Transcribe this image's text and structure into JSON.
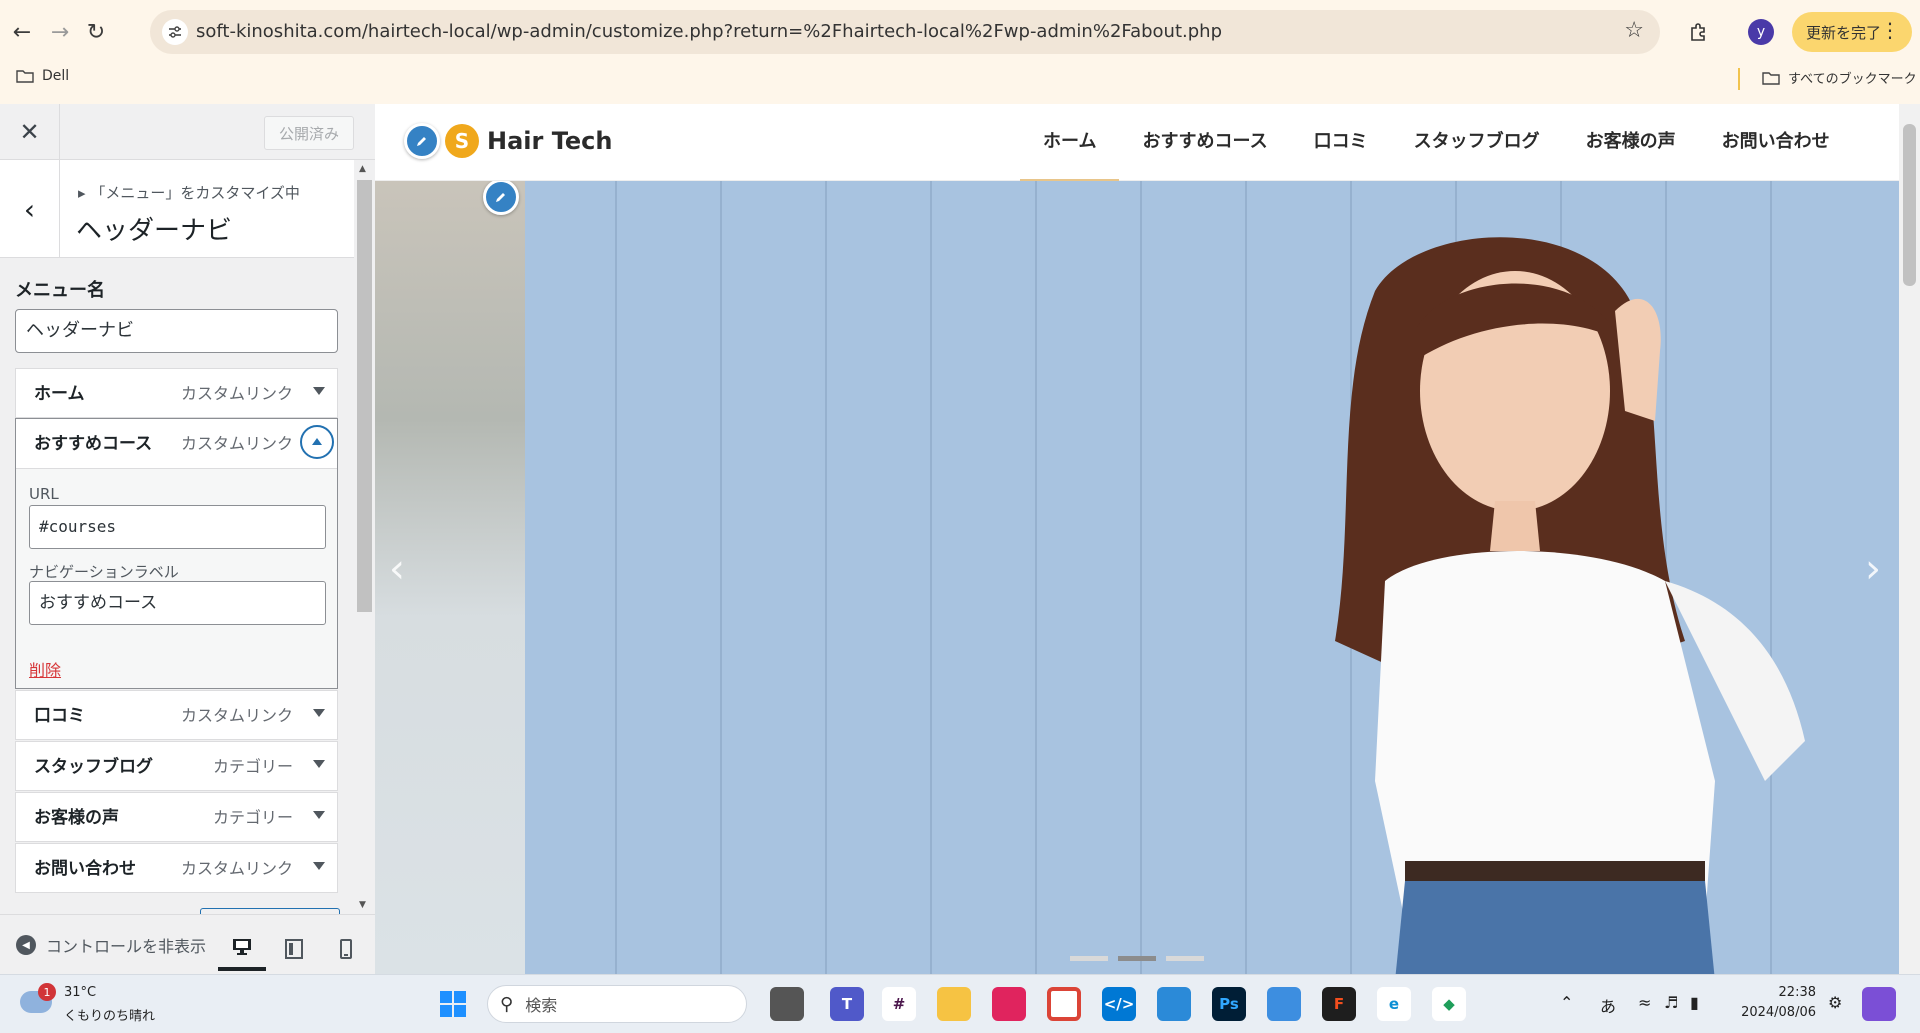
{
  "browser": {
    "url": "soft-kinoshita.com/hairtech-local/wp-admin/customize.php?return=%2Fhairtech-local%2Fwp-admin%2Fabout.php",
    "profile_initial": "y",
    "update_label": "更新を完了",
    "bookmarks": {
      "left": "Dell",
      "right": "すべてのブックマーク"
    }
  },
  "customizer": {
    "published_label": "公開済み",
    "breadcrumb": "「メニュー」をカスタマイズ中",
    "section_title": "ヘッダーナビ",
    "menu_name_label": "メニュー名",
    "menu_name_value": "ヘッダーナビ",
    "items": [
      {
        "title": "ホーム",
        "type": "カスタムリンク"
      },
      {
        "title": "おすすめコース",
        "type": "カスタムリンク"
      },
      {
        "title": "口コミ",
        "type": "カスタムリンク"
      },
      {
        "title": "スタッフブログ",
        "type": "カテゴリー"
      },
      {
        "title": "お客様の声",
        "type": "カテゴリー"
      },
      {
        "title": "お問い合わせ",
        "type": "カスタムリンク"
      }
    ],
    "expanded": {
      "url_label": "URL",
      "url_value": "#courses",
      "nav_label_label": "ナビゲーションラベル",
      "nav_label_value": "おすすめコース",
      "delete_label": "削除"
    },
    "hide_controls_label": "コントロールを非表示"
  },
  "site": {
    "logo_mark": "S",
    "logo_text": "Hair Tech",
    "nav": [
      "ホーム",
      "おすすめコース",
      "口コミ",
      "スタッフブログ",
      "お客様の声",
      "お問い合わせ"
    ],
    "active_nav_index": 0,
    "slider": {
      "slides": 3,
      "active": 2
    }
  },
  "taskbar": {
    "weather_badge": "1",
    "temperature": "31°C",
    "condition": "くもりのち晴れ",
    "search_placeholder": "検索",
    "ime": "あ",
    "time": "22:38",
    "date": "2024/08/06"
  },
  "colors": {
    "browser_bg": "#fef6ea",
    "update_button": "#fbd66e",
    "wp_accent": "#2271b1",
    "delete_red": "#d63638",
    "hero_wall": "#a8c3e0"
  }
}
